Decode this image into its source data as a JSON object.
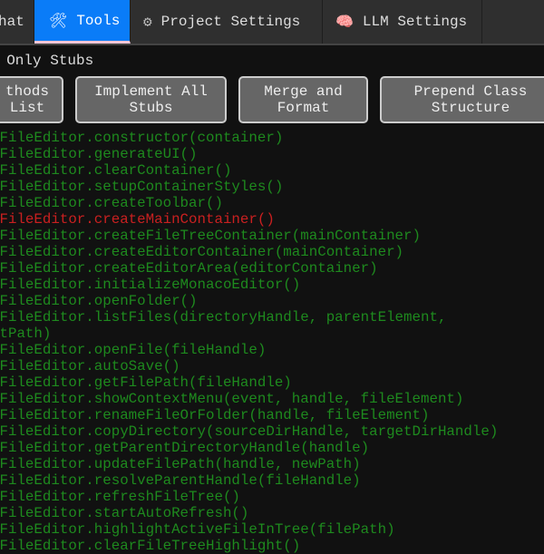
{
  "tabs": [
    {
      "label": "hat",
      "icon": ""
    },
    {
      "label": "Tools",
      "icon": "tools-icon",
      "glyph": "🛠"
    },
    {
      "label": "Project Settings",
      "icon": "gear-icon",
      "glyph": "⚙"
    },
    {
      "label": "LLM Settings",
      "icon": "brain-icon",
      "glyph": "🧠"
    }
  ],
  "filter_label": "w Only Stubs",
  "buttons": [
    "thods\nList",
    "Implement All\nStubs",
    "Merge and\nFormat",
    "Prepend Class\nStructure"
  ],
  "methods": [
    "dFileEditor.constructor(container)",
    "dFileEditor.generateUI()",
    "dFileEditor.clearContainer()",
    "dFileEditor.setupContainerStyles()",
    "dFileEditor.createToolbar()",
    "dFileEditor.createMainContainer()",
    "dFileEditor.createFileTreeContainer(mainContainer)",
    "dFileEditor.createEditorContainer(mainContainer)",
    "dFileEditor.createEditorArea(editorContainer)",
    "dFileEditor.initializeMonacoEditor()",
    "dFileEditor.openFolder()",
    "dFileEditor.listFiles(directoryHandle, parentElement,\nntPath)",
    "dFileEditor.openFile(fileHandle)",
    "dFileEditor.autoSave()",
    "dFileEditor.getFilePath(fileHandle)",
    "dFileEditor.showContextMenu(event, handle, fileElement)",
    "dFileEditor.renameFileOrFolder(handle, fileElement)",
    "dFileEditor.copyDirectory(sourceDirHandle, targetDirHandle)",
    "dFileEditor.getParentDirectoryHandle(handle)",
    "dFileEditor.updateFilePath(handle, newPath)",
    "dFileEditor.resolveParentHandle(fileHandle)",
    "dFileEditor.refreshFileTree()",
    "dFileEditor.startAutoRefresh()",
    "dFileEditor.highlightActiveFileInTree(filePath)",
    "dFileEditor.clearFileTreeHighlight()"
  ],
  "highlighted_index": 5,
  "colors": {
    "active_tab": "#0a7cf8",
    "method": "#1e8a1e",
    "error": "#c92020"
  }
}
